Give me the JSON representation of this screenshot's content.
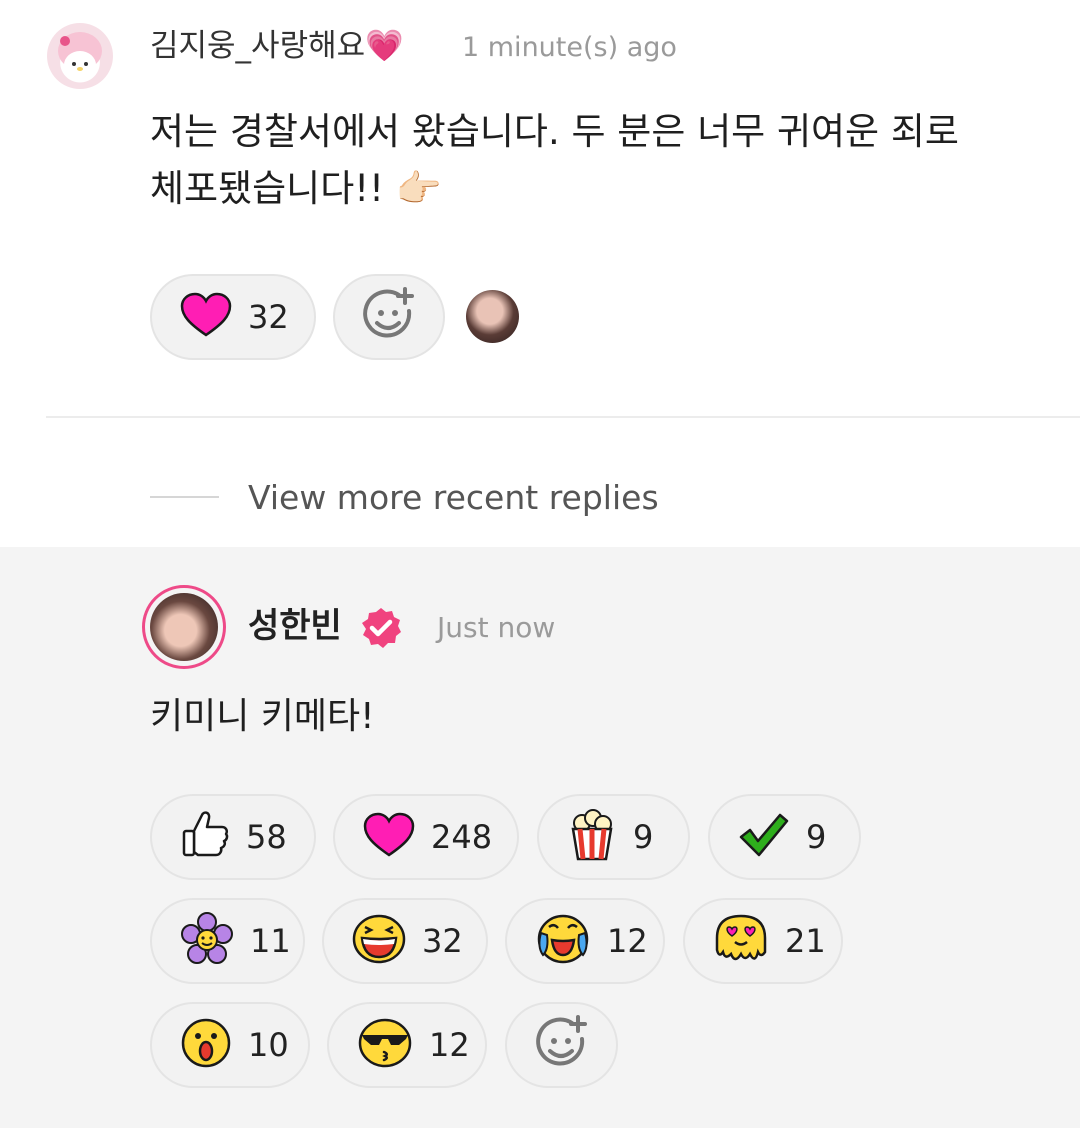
{
  "comment": {
    "username": "김지웅_사랑해요",
    "username_emoji": "💗",
    "timestamp": "1 minute(s) ago",
    "text_line1": "저는 경찰서에서 왔습니다. 두 분은 너무 귀여운 죄로",
    "text_line2": "체포됐습니다!! 👉🏻",
    "reactions": [
      {
        "icon": "heart-icon",
        "count": "32"
      }
    ]
  },
  "view_more_replies": "View more recent replies",
  "reply": {
    "username": "성한빈",
    "verified": true,
    "timestamp": "Just now",
    "text": "키미니 키메타!",
    "reactions": [
      {
        "icon": "thumbs-up-icon",
        "count": "58"
      },
      {
        "icon": "heart-icon",
        "count": "248"
      },
      {
        "icon": "popcorn-icon",
        "count": "9"
      },
      {
        "icon": "checkmark-icon",
        "count": "9"
      },
      {
        "icon": "flower-icon",
        "count": "11"
      },
      {
        "icon": "laughing-face-icon",
        "count": "32"
      },
      {
        "icon": "crying-laughing-face-icon",
        "count": "12"
      },
      {
        "icon": "heart-eyes-melting-face-icon",
        "count": "21"
      },
      {
        "icon": "surprised-face-icon",
        "count": "10"
      },
      {
        "icon": "sunglasses-kiss-face-icon",
        "count": "12"
      }
    ]
  },
  "colors": {
    "heart": "#ff1eb4",
    "verified": "#f0437f",
    "avatar_ring": "#ee4a88",
    "check": "#2eae1c",
    "emoji_yellow": "#ffd93b",
    "flower_purple": "#b784e6"
  }
}
